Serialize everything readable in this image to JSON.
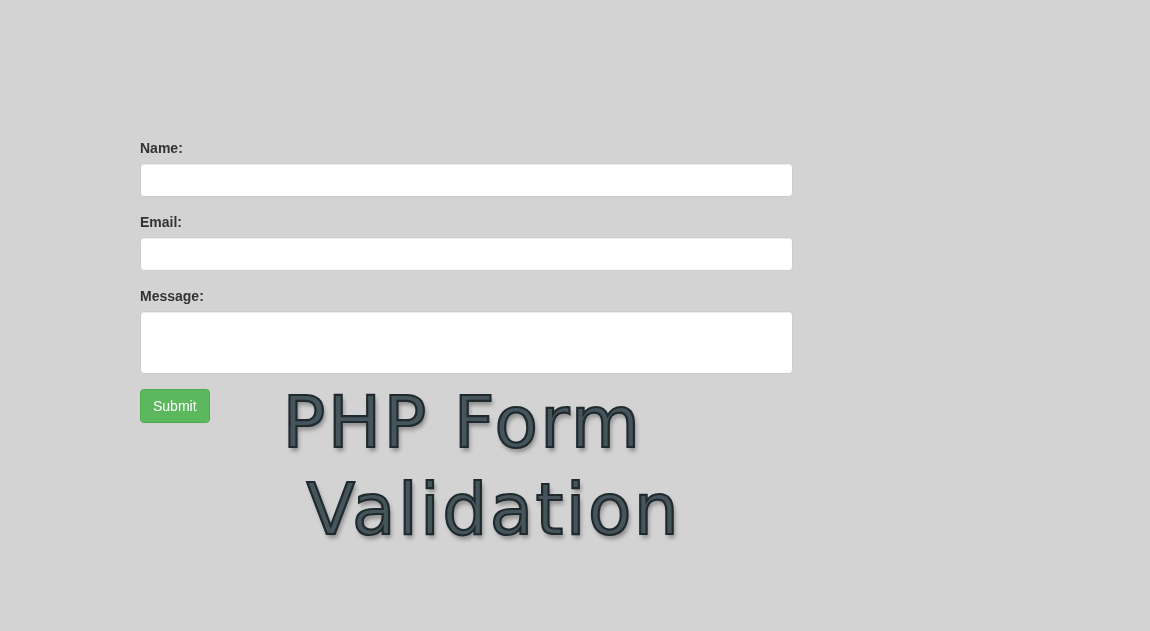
{
  "form": {
    "fields": [
      {
        "label": "Name:",
        "kind": "input"
      },
      {
        "label": "Email:",
        "kind": "input"
      },
      {
        "label": "Message:",
        "kind": "textarea"
      }
    ],
    "submit_button": "Submit"
  },
  "title": {
    "lines": [
      "PHP Form",
      "Validation"
    ]
  }
}
